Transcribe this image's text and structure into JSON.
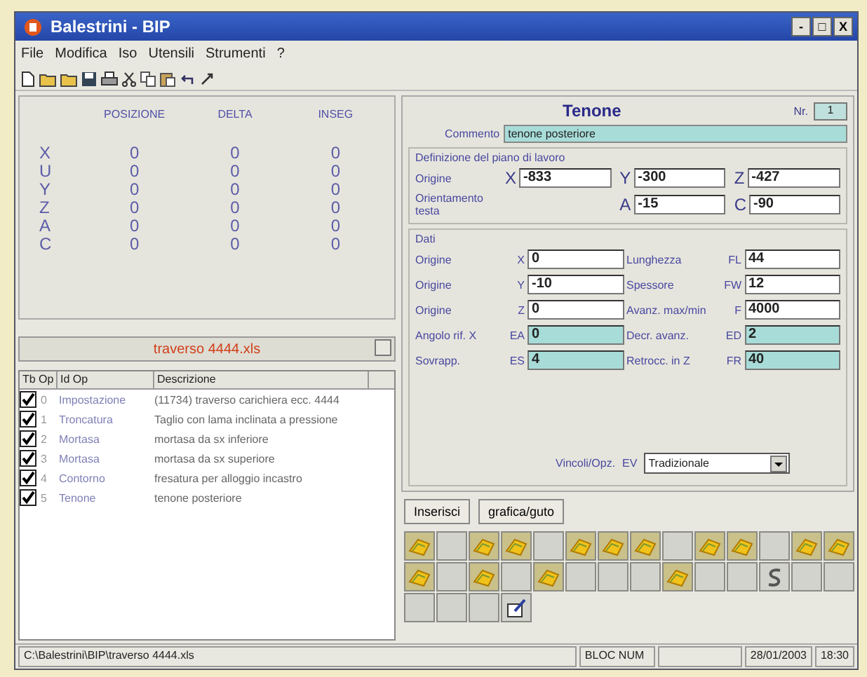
{
  "window": {
    "title": "Balestrini - BIP",
    "controls": [
      "-",
      "□",
      "X"
    ]
  },
  "menu": [
    "File",
    "Modifica",
    "Iso",
    "Utensili",
    "Strumenti",
    "?"
  ],
  "position_table": {
    "columns": [
      "POSIZIONE",
      "DELTA",
      "INSEG"
    ],
    "rows": [
      {
        "axis": "X",
        "values": [
          "0",
          "0",
          "0"
        ]
      },
      {
        "axis": "U",
        "values": [
          "0",
          "0",
          "0"
        ]
      },
      {
        "axis": "Y",
        "values": [
          "0",
          "0",
          "0"
        ]
      },
      {
        "axis": "Z",
        "values": [
          "0",
          "0",
          "0"
        ]
      },
      {
        "axis": "A",
        "values": [
          "0",
          "0",
          "0"
        ]
      },
      {
        "axis": "C",
        "values": [
          "0",
          "0",
          "0"
        ]
      }
    ]
  },
  "file_bar": {
    "name": "traverso 4444.xls"
  },
  "operations": {
    "columns": [
      "Tb Op",
      "Id Op",
      "Descrizione"
    ],
    "rows": [
      {
        "checked": true,
        "number": "0",
        "id": "Impostazione",
        "description": "(11734) traverso carichiera ecc. 4444"
      },
      {
        "checked": true,
        "number": "1",
        "id": "Troncatura",
        "description": "Taglio con lama inclinata a pressione"
      },
      {
        "checked": true,
        "number": "2",
        "id": "Mortasa",
        "description": "mortasa da sx inferiore"
      },
      {
        "checked": true,
        "number": "3",
        "id": "Mortasa",
        "description": "mortasa da sx superiore"
      },
      {
        "checked": true,
        "number": "4",
        "id": "Contorno",
        "description": "fresatura per alloggio incastro"
      },
      {
        "checked": true,
        "number": "5",
        "id": "Tenone",
        "description": "tenone posteriore"
      }
    ]
  },
  "form": {
    "title": "Tenone",
    "nr_label": "Nr.",
    "nr_value": "1",
    "comment_label": "Commento",
    "comment_value": "tenone posteriore",
    "plane": {
      "title": "Definizione del piano di lavoro",
      "rows": [
        {
          "label": "Origine",
          "fields": [
            {
              "axis": "X",
              "value": "-833"
            },
            {
              "axis": "Y",
              "value": "-300"
            },
            {
              "axis": "Z",
              "value": "-427"
            }
          ]
        },
        {
          "label": "Orientamento testa",
          "fields": [
            {
              "axis": "A",
              "value": "-15"
            },
            {
              "axis": "C",
              "value": "-90"
            }
          ]
        }
      ]
    },
    "data": {
      "title": "Dati",
      "rows": [
        {
          "left": {
            "label": "Origine",
            "code": "X",
            "value": "0",
            "kind": "plain"
          },
          "right": {
            "label": "Lunghezza",
            "code": "FL",
            "value": "44",
            "kind": "plain"
          }
        },
        {
          "left": {
            "label": "Origine",
            "code": "Y",
            "value": "-10",
            "kind": "plain"
          },
          "right": {
            "label": "Spessore",
            "code": "FW",
            "value": "12",
            "kind": "plain"
          }
        },
        {
          "left": {
            "label": "Origine",
            "code": "Z",
            "value": "0",
            "kind": "plain"
          },
          "right": {
            "label": "Avanz. max/min",
            "code": "F",
            "value": "4000",
            "kind": "plain"
          }
        },
        {
          "left": {
            "label": "Angolo rif. X",
            "code": "EA",
            "value": "0",
            "kind": "shaded"
          },
          "right": {
            "label": "Decr. avanz.",
            "code": "ED",
            "value": "2",
            "kind": "shaded"
          }
        },
        {
          "left": {
            "label": "Sovrapp.",
            "code": "ES",
            "value": "4",
            "kind": "shaded"
          },
          "right": {
            "label": "Retrocc. in Z",
            "code": "FR",
            "value": "40",
            "kind": "shaded"
          }
        }
      ]
    },
    "constraint": {
      "label": "Vincoli/Opz.",
      "code": "EV",
      "value": "Tradizionale"
    }
  },
  "buttons": [
    "Inserisci",
    "grafica/guto"
  ],
  "palette": [
    [
      {
        "kind": "tool"
      },
      {
        "kind": "empty"
      },
      {
        "kind": "tool"
      },
      {
        "kind": "tool"
      },
      {
        "kind": "empty"
      },
      {
        "kind": "tool"
      },
      {
        "kind": "tool"
      },
      {
        "kind": "tool"
      },
      {
        "kind": "empty"
      },
      {
        "kind": "tool"
      },
      {
        "kind": "tool"
      },
      {
        "kind": "empty"
      },
      {
        "kind": "tool"
      },
      {
        "kind": "tool"
      }
    ],
    [
      {
        "kind": "tool"
      },
      {
        "kind": "empty"
      },
      {
        "kind": "tool"
      },
      {
        "kind": "empty"
      },
      {
        "kind": "tool"
      },
      {
        "kind": "empty"
      },
      {
        "kind": "empty"
      },
      {
        "kind": "empty"
      },
      {
        "kind": "tool"
      },
      {
        "kind": "empty"
      },
      {
        "kind": "empty"
      },
      {
        "kind": "curve"
      },
      {
        "kind": "empty"
      },
      {
        "kind": "empty"
      }
    ],
    [
      {
        "kind": "empty"
      },
      {
        "kind": "empty"
      },
      {
        "kind": "empty"
      },
      {
        "kind": "edit"
      }
    ]
  ],
  "status_bar": {
    "path": "C:\\Balestrini\\BIP\\traverso 4444.xls",
    "numlock": "BLOC NUM",
    "date": "28/01/2003",
    "time": "18:30"
  }
}
